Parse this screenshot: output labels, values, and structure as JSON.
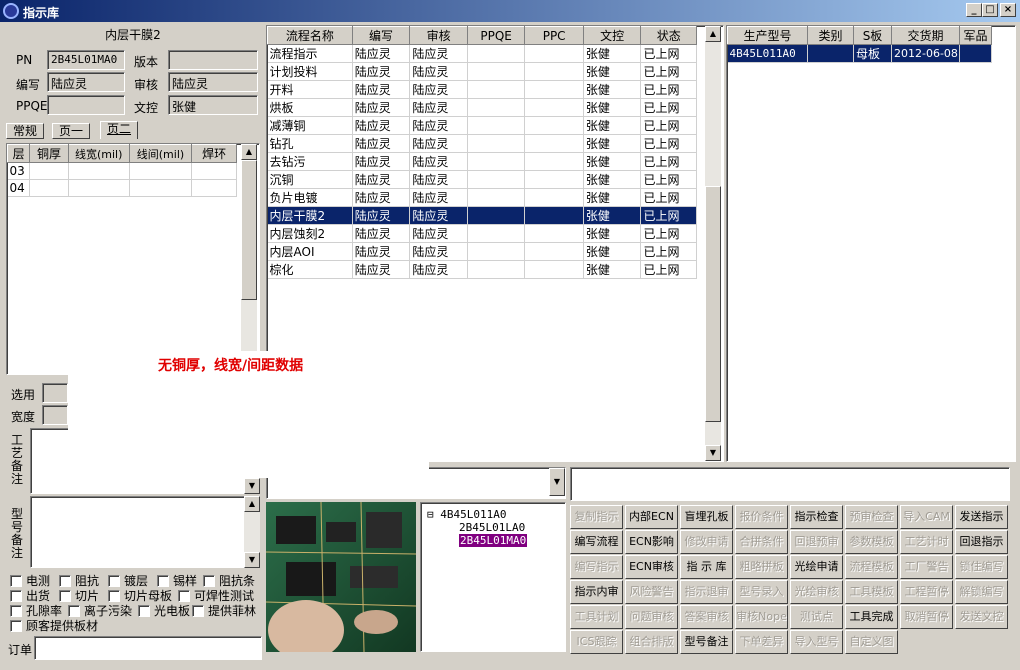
{
  "window": {
    "title": "指示库",
    "controls": {
      "minimize": "_",
      "maximize": "□",
      "close": "×"
    }
  },
  "left": {
    "title": "内层干膜2",
    "fields": {
      "pn_label": "PN",
      "pn_value": "2B45L01MA0",
      "version_label": "版本",
      "version_value": "",
      "author_label": "编写",
      "author_value": "陆应灵",
      "review_label": "审核",
      "review_value": "陆应灵",
      "ppqe_label": "PPQE",
      "ppqe_value": "",
      "doc_label": "文控",
      "doc_value": "张健"
    },
    "tabs": [
      "常规",
      "页一",
      "页二"
    ],
    "active_tab": "页二",
    "layer_table": {
      "headers": [
        "层",
        "铜厚",
        "线宽(mil)",
        "线间(mil)",
        "焊环"
      ],
      "rows": [
        [
          "03",
          "",
          "",
          "",
          ""
        ],
        [
          "04",
          "",
          "",
          "",
          ""
        ]
      ]
    },
    "select_label": "选用",
    "width_label": "宽度",
    "process_note_label": "工艺备注",
    "model_note_label": "型号备注",
    "checkboxes": [
      [
        "电测",
        "阻抗",
        "镀层",
        "锡样",
        "阻抗条"
      ],
      [
        "出货",
        "切片",
        "切片母板",
        "可焊性测试"
      ],
      [
        "孔隙率",
        "离子污染",
        "光电板",
        "提供菲林"
      ],
      [
        "顾客提供板材"
      ]
    ],
    "order_label": "订单"
  },
  "overlay": {
    "message": "无铜厚，线宽/间距数据"
  },
  "flow_table": {
    "headers": [
      "流程名称",
      "编写",
      "审核",
      "PPQE",
      "PPC",
      "文控",
      "状态"
    ],
    "rows": [
      [
        "流程指示",
        "陆应灵",
        "陆应灵",
        "",
        "",
        "张健",
        "已上网"
      ],
      [
        "计划投料",
        "陆应灵",
        "陆应灵",
        "",
        "",
        "张健",
        "已上网"
      ],
      [
        "开料",
        "陆应灵",
        "陆应灵",
        "",
        "",
        "张健",
        "已上网"
      ],
      [
        "烘板",
        "陆应灵",
        "陆应灵",
        "",
        "",
        "张健",
        "已上网"
      ],
      [
        "减薄铜",
        "陆应灵",
        "陆应灵",
        "",
        "",
        "张健",
        "已上网"
      ],
      [
        "钻孔",
        "陆应灵",
        "陆应灵",
        "",
        "",
        "张健",
        "已上网"
      ],
      [
        "去钻污",
        "陆应灵",
        "陆应灵",
        "",
        "",
        "张健",
        "已上网"
      ],
      [
        "沉铜",
        "陆应灵",
        "陆应灵",
        "",
        "",
        "张健",
        "已上网"
      ],
      [
        "负片电镀",
        "陆应灵",
        "陆应灵",
        "",
        "",
        "张健",
        "已上网"
      ],
      [
        "内层干膜2",
        "陆应灵",
        "陆应灵",
        "",
        "",
        "张健",
        "已上网"
      ],
      [
        "内层蚀刻2",
        "陆应灵",
        "陆应灵",
        "",
        "",
        "张健",
        "已上网"
      ],
      [
        "内层AOI",
        "陆应灵",
        "陆应灵",
        "",
        "",
        "张健",
        "已上网"
      ],
      [
        "棕化",
        "陆应灵",
        "陆应灵",
        "",
        "",
        "张健",
        "已上网"
      ]
    ],
    "selected_row": 9
  },
  "model_table": {
    "headers": [
      "生产型号",
      "类别",
      "S板",
      "交货期",
      "军品"
    ],
    "rows": [
      [
        "4B45L011A0",
        "",
        "母板",
        "2012-06-08",
        ""
      ]
    ]
  },
  "tree": {
    "root": "4B45L011A0",
    "children": [
      "2B45L01LA0",
      "2B45L01MA0"
    ],
    "toggle": "⊟"
  },
  "buttons": [
    [
      "复制指示",
      "内部ECN",
      "盲埋孔板",
      "报价条件",
      "指示检查",
      "预审检查",
      "导入CAM",
      "发送指示"
    ],
    [
      "编写流程",
      "ECN影响",
      "修改申请",
      "合拼条件",
      "回退预审",
      "参数模板",
      "工艺计时",
      "回退指示"
    ],
    [
      "编写指示",
      "ECN审核",
      "指 示 库",
      "粗略拼板",
      "光绘申请",
      "流程模板",
      "工厂警告",
      "锁住编写"
    ],
    [
      "指示内审",
      "风险警告",
      "指示退审",
      "型号录入",
      "光绘审核",
      "工具模板",
      "工程暂停",
      "解锁编写"
    ],
    [
      "工具计划",
      "问题审核",
      "答案审核",
      "审核Nope",
      "测试点",
      "工具完成",
      "取消暂停",
      "发送文控"
    ],
    [
      "ICS跟踪",
      "组合排版",
      "型号备注",
      "下单差异",
      "导入型号",
      "自定义图"
    ]
  ],
  "buttons_enabled": [
    [
      false,
      true,
      true,
      false,
      true,
      false,
      false,
      true
    ],
    [
      true,
      true,
      false,
      false,
      false,
      false,
      false,
      true
    ],
    [
      false,
      true,
      true,
      false,
      true,
      false,
      false,
      false
    ],
    [
      true,
      false,
      false,
      false,
      false,
      false,
      false,
      false
    ],
    [
      false,
      false,
      false,
      false,
      false,
      true,
      false,
      false
    ],
    [
      false,
      false,
      true,
      false,
      false,
      false
    ]
  ],
  "colors": {
    "selection": "#0a246a",
    "tree_selection": "#800080",
    "overlay_text": "#e00000"
  }
}
